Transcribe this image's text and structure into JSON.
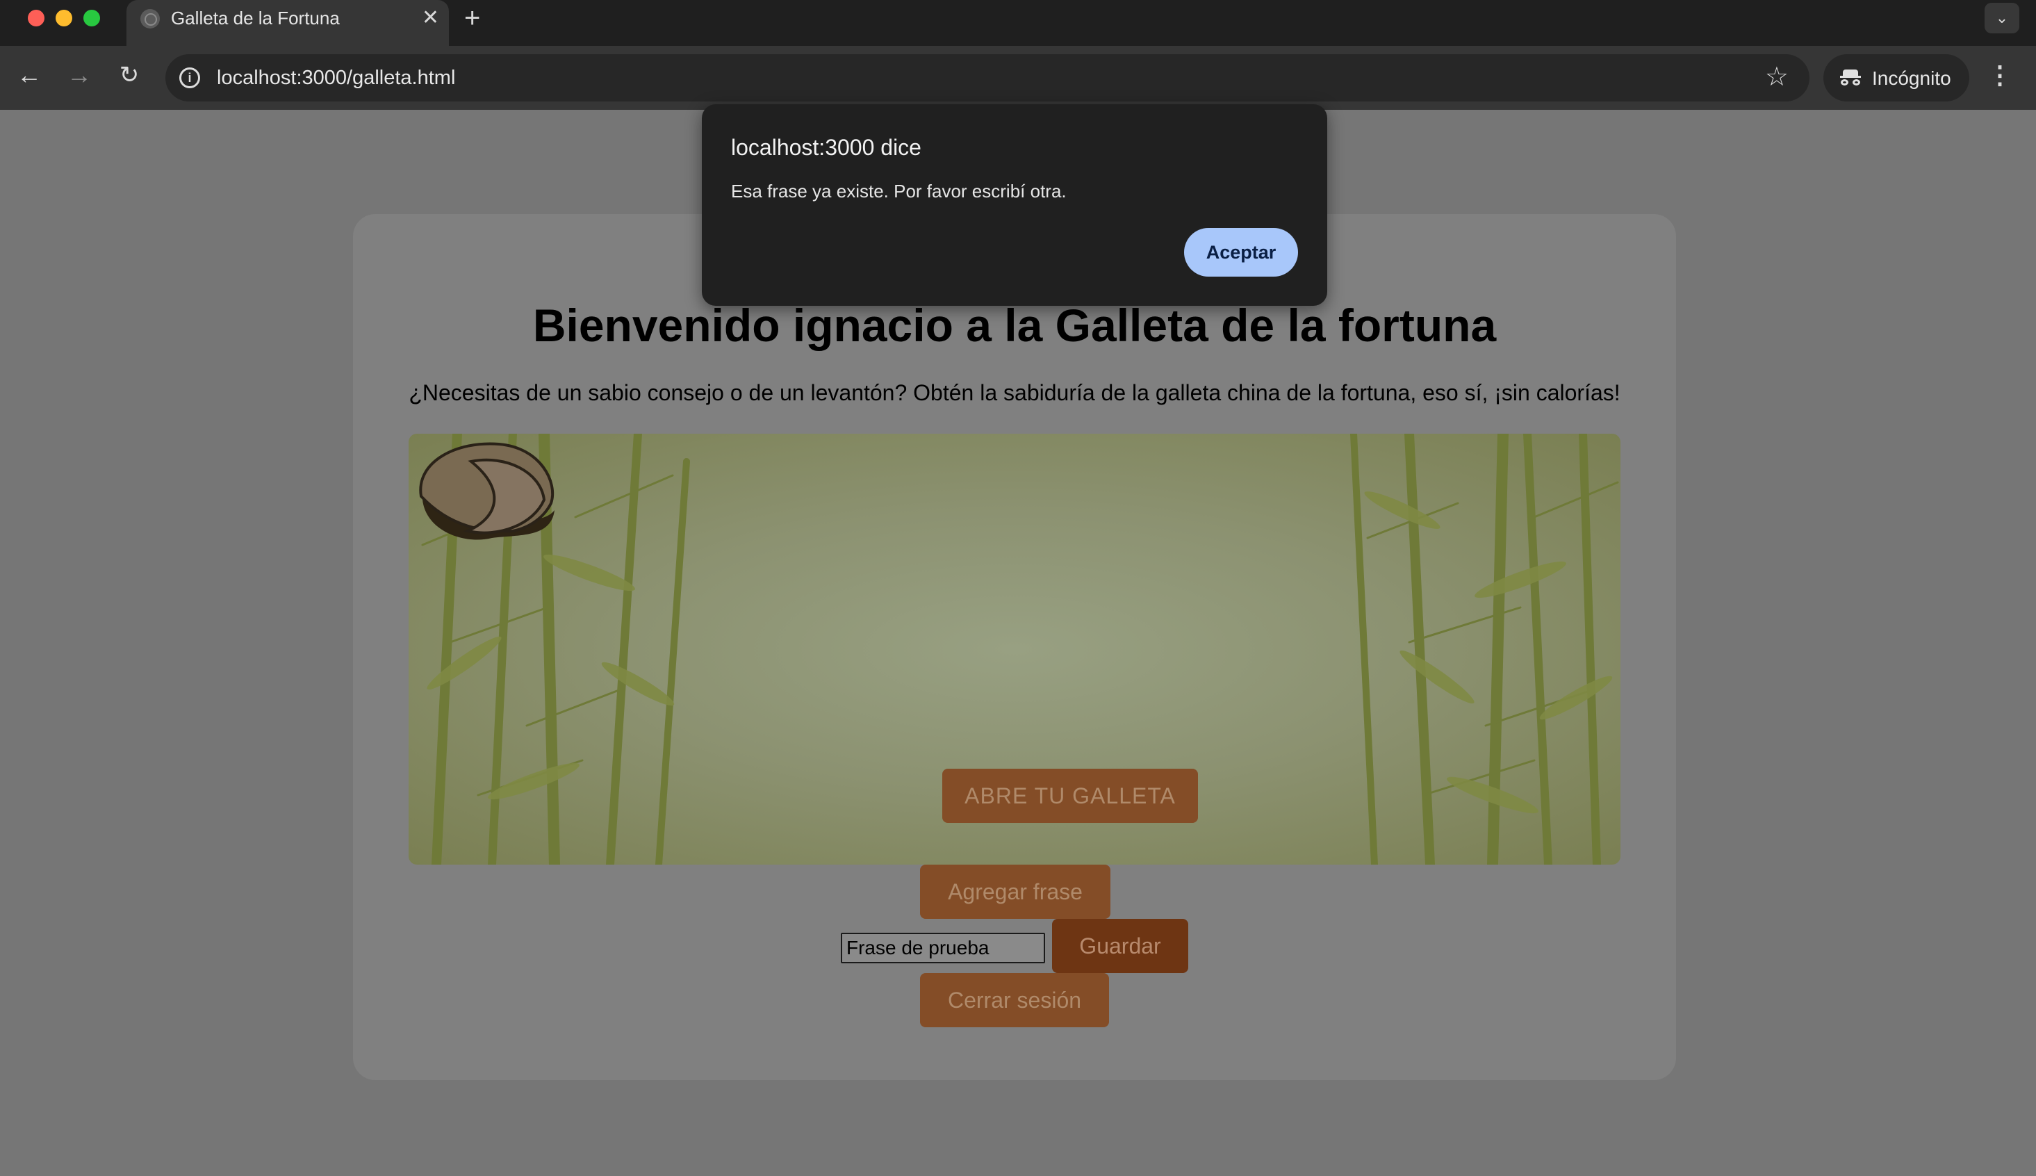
{
  "browser": {
    "tab_title": "Galleta de la Fortuna",
    "tab_close": "✕",
    "new_tab": "+",
    "url": "localhost:3000/galleta.html",
    "incognito_label": "Incógnito"
  },
  "page": {
    "title": "Bienvenido ignacio a la Galleta de la fortuna",
    "subtitle": "¿Necesitas de un sabio consejo o de un levantón? Obtén la sabiduría de la galleta china de la fortuna, eso sí, ¡sin calorías!",
    "open_button": "ABRE TU GALLETA",
    "add_phrase_button": "Agregar frase",
    "phrase_input_value": "Frase de prueba",
    "save_button": "Guardar",
    "logout_button": "Cerrar sesión"
  },
  "dialog": {
    "title": "localhost:3000 dice",
    "message": "Esa frase ya existe. Por favor escribí otra.",
    "ok_button": "Aceptar"
  },
  "icons": {
    "tab_favicon": "globe-icon",
    "back": "arrow-left-icon",
    "forward": "arrow-right-icon",
    "reload": "reload-icon",
    "site_info": "info-icon",
    "bookmark": "star-icon",
    "incognito": "incognito-icon",
    "menu": "kebab-menu-icon",
    "tab_search": "chevron-down-icon"
  },
  "colors": {
    "overlay_background": "#767676",
    "card": "#808080",
    "button": "#844d27",
    "save_button": "#6e3513",
    "dialog_background": "#202020",
    "dialog_button": "#a8c7fa"
  }
}
